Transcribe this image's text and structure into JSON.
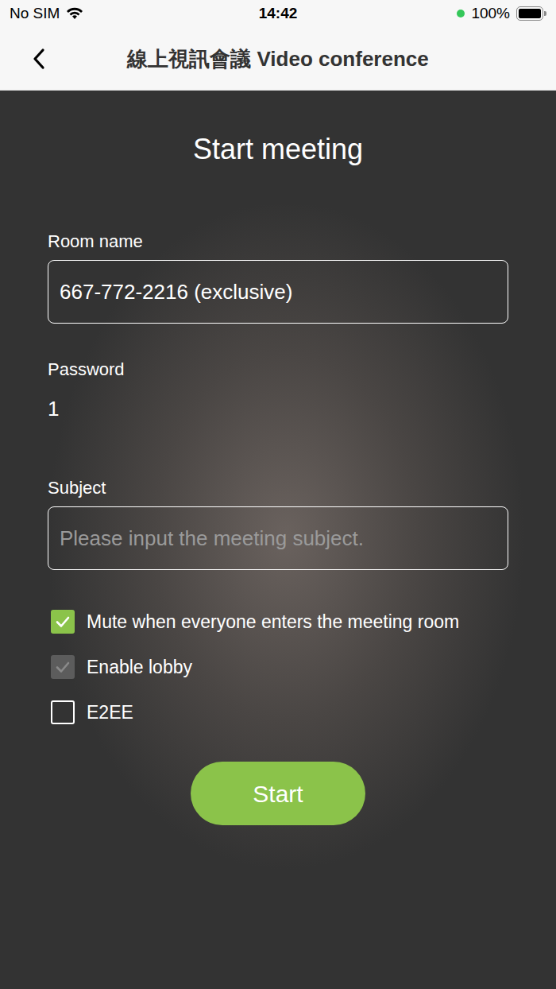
{
  "status_bar": {
    "carrier": "No SIM",
    "time": "14:42",
    "camera_in_use": true,
    "battery": "100%",
    "battery_level": 1
  },
  "nav": {
    "title": "線上視訊會議 Video conference"
  },
  "form": {
    "heading": "Start meeting",
    "room_label": "Room name",
    "room_value": "667-772-2216 (exclusive)",
    "password_label": "Password",
    "password_value": "1",
    "subject_label": "Subject",
    "subject_placeholder": "Please input the meeting subject.",
    "options": [
      {
        "label": "Mute when everyone enters the meeting room",
        "checked": true,
        "disabled": false
      },
      {
        "label": "Enable lobby",
        "checked": true,
        "disabled": true
      },
      {
        "label": "E2EE",
        "checked": false,
        "disabled": false
      }
    ],
    "button": "Start"
  }
}
